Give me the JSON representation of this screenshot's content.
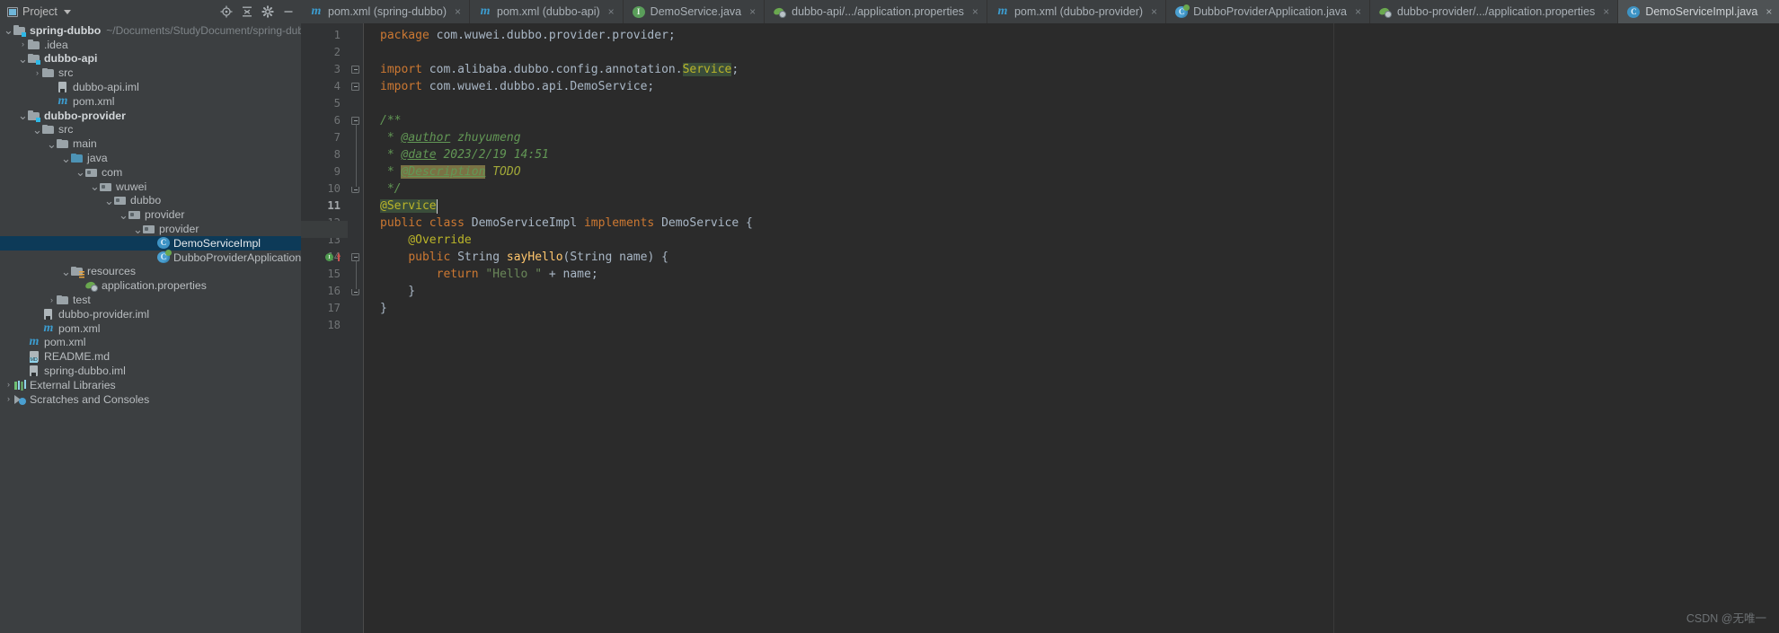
{
  "project_panel": {
    "title": "Project",
    "tools": [
      "locate-icon",
      "collapse-all-icon",
      "settings-icon",
      "hide-icon"
    ],
    "tree": [
      {
        "indent": 0,
        "arrow": "v",
        "icon": "folder-module",
        "label": "spring-dubbo",
        "bold": true,
        "path": "~/Documents/StudyDocument/spring-dubbo"
      },
      {
        "indent": 1,
        "arrow": ">",
        "icon": "folder",
        "label": ".idea"
      },
      {
        "indent": 1,
        "arrow": "v",
        "icon": "folder-module",
        "label": "dubbo-api",
        "bold": true
      },
      {
        "indent": 2,
        "arrow": ">",
        "icon": "folder",
        "label": "src"
      },
      {
        "indent": 3,
        "arrow": "",
        "icon": "iml",
        "label": "dubbo-api.iml"
      },
      {
        "indent": 3,
        "arrow": "",
        "icon": "maven",
        "label": "pom.xml"
      },
      {
        "indent": 1,
        "arrow": "v",
        "icon": "folder-module",
        "label": "dubbo-provider",
        "bold": true
      },
      {
        "indent": 2,
        "arrow": "v",
        "icon": "folder",
        "label": "src"
      },
      {
        "indent": 3,
        "arrow": "v",
        "icon": "folder",
        "label": "main"
      },
      {
        "indent": 4,
        "arrow": "v",
        "icon": "folder-source",
        "label": "java"
      },
      {
        "indent": 5,
        "arrow": "v",
        "icon": "package",
        "label": "com"
      },
      {
        "indent": 6,
        "arrow": "v",
        "icon": "package",
        "label": "wuwei"
      },
      {
        "indent": 7,
        "arrow": "v",
        "icon": "package",
        "label": "dubbo"
      },
      {
        "indent": 8,
        "arrow": "v",
        "icon": "package",
        "label": "provider"
      },
      {
        "indent": 9,
        "arrow": "v",
        "icon": "package",
        "label": "provider"
      },
      {
        "indent": 10,
        "arrow": "",
        "icon": "class",
        "label": "DemoServiceImpl",
        "selected": true
      },
      {
        "indent": 10,
        "arrow": "",
        "icon": "spring-class",
        "label": "DubboProviderApplication"
      },
      {
        "indent": 4,
        "arrow": "v",
        "icon": "folder-resources",
        "label": "resources"
      },
      {
        "indent": 5,
        "arrow": "",
        "icon": "properties",
        "label": "application.properties"
      },
      {
        "indent": 3,
        "arrow": ">",
        "icon": "folder",
        "label": "test"
      },
      {
        "indent": 2,
        "arrow": "",
        "icon": "iml",
        "label": "dubbo-provider.iml"
      },
      {
        "indent": 2,
        "arrow": "",
        "icon": "maven",
        "label": "pom.xml"
      },
      {
        "indent": 1,
        "arrow": "",
        "icon": "maven",
        "label": "pom.xml"
      },
      {
        "indent": 1,
        "arrow": "",
        "icon": "markdown",
        "label": "README.md"
      },
      {
        "indent": 1,
        "arrow": "",
        "icon": "iml",
        "label": "spring-dubbo.iml"
      },
      {
        "indent": 0,
        "arrow": ">",
        "icon": "libraries",
        "label": "External Libraries"
      },
      {
        "indent": 0,
        "arrow": ">",
        "icon": "scratches",
        "label": "Scratches and Consoles"
      }
    ]
  },
  "tabs": [
    {
      "icon": "maven",
      "label": "pom.xml (spring-dubbo)",
      "active": false,
      "close": "×"
    },
    {
      "icon": "maven",
      "label": "pom.xml (dubbo-api)",
      "active": false,
      "close": "×"
    },
    {
      "icon": "interface",
      "label": "DemoService.java",
      "active": false,
      "close": "×"
    },
    {
      "icon": "properties",
      "label": "dubbo-api/.../application.properties",
      "active": false,
      "close": "×"
    },
    {
      "icon": "maven",
      "label": "pom.xml (dubbo-provider)",
      "active": false,
      "close": "×"
    },
    {
      "icon": "spring-class",
      "label": "DubboProviderApplication.java",
      "active": false,
      "close": "×"
    },
    {
      "icon": "properties",
      "label": "dubbo-provider/.../application.properties",
      "active": false,
      "close": "×"
    },
    {
      "icon": "class",
      "label": "DemoServiceImpl.java",
      "active": true,
      "close": "×"
    }
  ],
  "editor": {
    "caret_line": 11,
    "lines": [
      {
        "n": 1,
        "tokens": [
          {
            "t": "package ",
            "c": "kw"
          },
          {
            "t": "com.wuwei.dubbo.provider.provider;",
            "c": "typ"
          }
        ]
      },
      {
        "n": 2,
        "tokens": []
      },
      {
        "n": 3,
        "fold": true,
        "tokens": [
          {
            "t": "import ",
            "c": "kw"
          },
          {
            "t": "com.alibaba.dubbo.config.annotation.",
            "c": "typ"
          },
          {
            "t": "Service",
            "c": "ann-hl"
          },
          {
            "t": ";",
            "c": "typ"
          }
        ]
      },
      {
        "n": 4,
        "fold": true,
        "tokens": [
          {
            "t": "import ",
            "c": "kw"
          },
          {
            "t": "com.wuwei.dubbo.api.DemoService;",
            "c": "typ"
          }
        ]
      },
      {
        "n": 5,
        "tokens": []
      },
      {
        "n": 6,
        "fold": true,
        "tokens": [
          {
            "t": "/**",
            "c": "cm"
          }
        ]
      },
      {
        "n": 7,
        "tokens": [
          {
            "t": " * ",
            "c": "cm"
          },
          {
            "t": "@author",
            "c": "cmtag"
          },
          {
            "t": " zhuyumeng",
            "c": "cm"
          }
        ]
      },
      {
        "n": 8,
        "tokens": [
          {
            "t": " * ",
            "c": "cm"
          },
          {
            "t": "@date",
            "c": "cmtag"
          },
          {
            "t": " 2023/2/19 14:51",
            "c": "cm"
          }
        ]
      },
      {
        "n": 9,
        "tokens": [
          {
            "t": " * ",
            "c": "cm"
          },
          {
            "t": "@Description",
            "c": "cmtag-hl"
          },
          {
            "t": " ",
            "c": "cm"
          },
          {
            "t": "TODO",
            "c": "todo"
          }
        ]
      },
      {
        "n": 10,
        "foldend": true,
        "tokens": [
          {
            "t": " */",
            "c": "cm"
          }
        ]
      },
      {
        "n": 11,
        "tokens": [
          {
            "t": "@Service",
            "c": "ann-hl"
          }
        ]
      },
      {
        "n": 12,
        "tokens": [
          {
            "t": "public class ",
            "c": "kw"
          },
          {
            "t": "DemoServiceImpl ",
            "c": "cls"
          },
          {
            "t": "implements ",
            "c": "kw"
          },
          {
            "t": "DemoService ",
            "c": "cls"
          },
          {
            "t": "{",
            "c": "typ"
          }
        ]
      },
      {
        "n": 13,
        "tokens": [
          {
            "t": "    @Override",
            "c": "ann"
          }
        ]
      },
      {
        "n": 14,
        "fold": true,
        "gutter_icon": "implements-marker",
        "tokens": [
          {
            "t": "    ",
            "c": "typ"
          },
          {
            "t": "public ",
            "c": "kw"
          },
          {
            "t": "String ",
            "c": "cls"
          },
          {
            "t": "sayHello",
            "c": "mth"
          },
          {
            "t": "(",
            "c": "typ"
          },
          {
            "t": "String ",
            "c": "cls"
          },
          {
            "t": "name",
            "c": "typ"
          },
          {
            "t": ") {",
            "c": "typ"
          }
        ]
      },
      {
        "n": 15,
        "tokens": [
          {
            "t": "        ",
            "c": "typ"
          },
          {
            "t": "return ",
            "c": "kw"
          },
          {
            "t": "\"Hello \"",
            "c": "str"
          },
          {
            "t": " + name;",
            "c": "typ"
          }
        ]
      },
      {
        "n": 16,
        "foldend": true,
        "tokens": [
          {
            "t": "    }",
            "c": "typ"
          }
        ]
      },
      {
        "n": 17,
        "tokens": [
          {
            "t": "}",
            "c": "typ"
          }
        ]
      },
      {
        "n": 18,
        "tokens": []
      }
    ]
  },
  "watermark": "CSDN @无唯一"
}
